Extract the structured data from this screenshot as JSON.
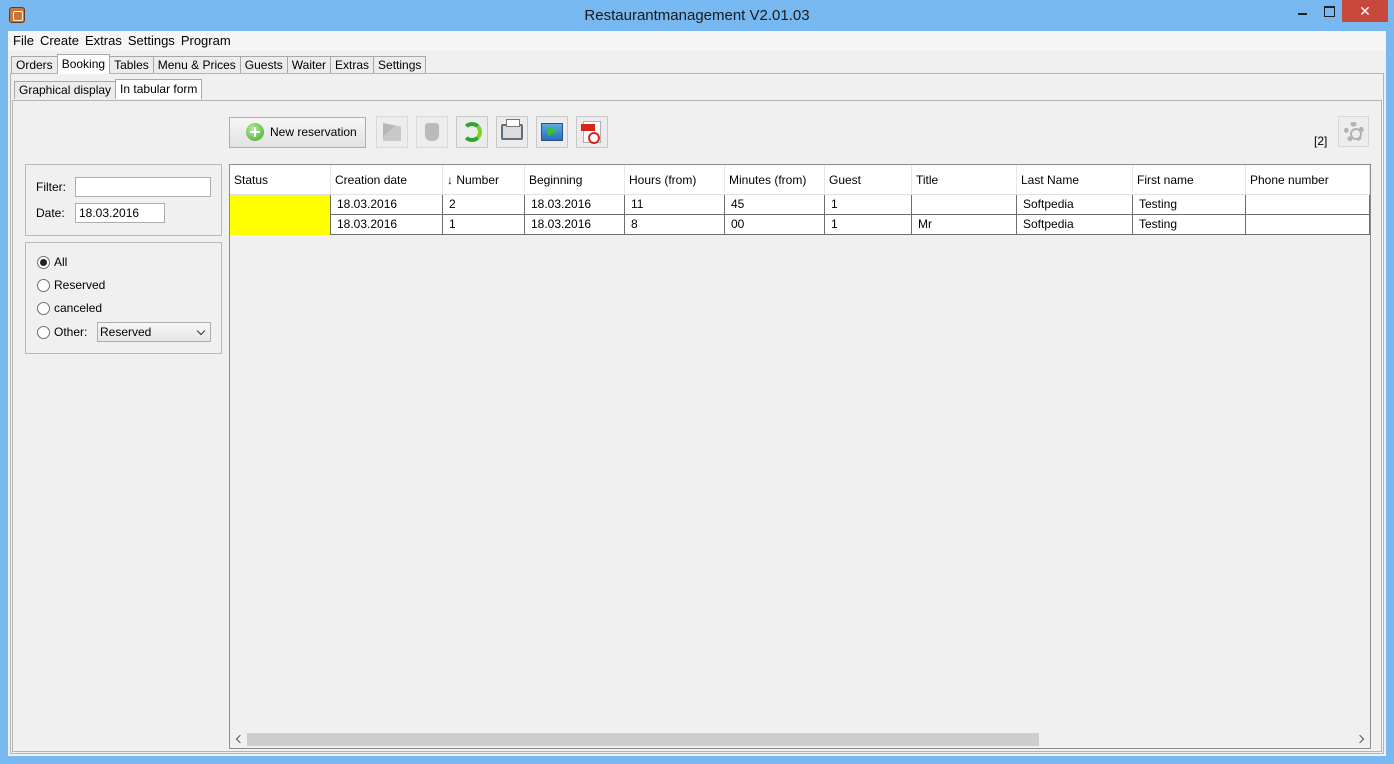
{
  "window": {
    "title": "Restaurantmanagement V2.01.03",
    "close_glyph": "✕"
  },
  "menu": [
    "File",
    "Create",
    "Extras",
    "Settings",
    "Program"
  ],
  "main_tabs": [
    "Orders",
    "Booking",
    "Tables",
    "Menu & Prices",
    "Guests",
    "Waiter",
    "Extras",
    "Settings"
  ],
  "main_tab_active": "Booking",
  "sub_tabs": [
    "Graphical display",
    "In tabular form"
  ],
  "sub_tab_active": "In tabular form",
  "toolbar": {
    "new_reservation_label": "New reservation",
    "icons": [
      "edit-icon",
      "delete-icon",
      "refresh-icon",
      "print-icon",
      "export-icon",
      "pdf-icon"
    ]
  },
  "record_count": "[2]",
  "filter": {
    "filter_label": "Filter:",
    "filter_value": "",
    "date_label": "Date:",
    "date_value": "18.03.2016"
  },
  "status_filter": {
    "options": [
      "All",
      "Reserved",
      "canceled",
      "Other:"
    ],
    "selected": "All",
    "other_select_value": "Reserved"
  },
  "table": {
    "columns": [
      "Status",
      "Creation date",
      "↓ Number",
      "Beginning",
      "Hours (from)",
      "Minutes (from)",
      "Guest",
      "Title",
      "Last Name",
      "First name",
      "Phone number"
    ],
    "rows": [
      [
        "",
        "18.03.2016",
        "2",
        "18.03.2016",
        "11",
        "45",
        "1",
        "",
        "Softpedia",
        "Testing",
        ""
      ],
      [
        "",
        "18.03.2016",
        "1",
        "18.03.2016",
        "8",
        "00",
        "1",
        "Mr",
        "Softpedia",
        "Testing",
        ""
      ]
    ],
    "status_color": "#ffff00"
  }
}
